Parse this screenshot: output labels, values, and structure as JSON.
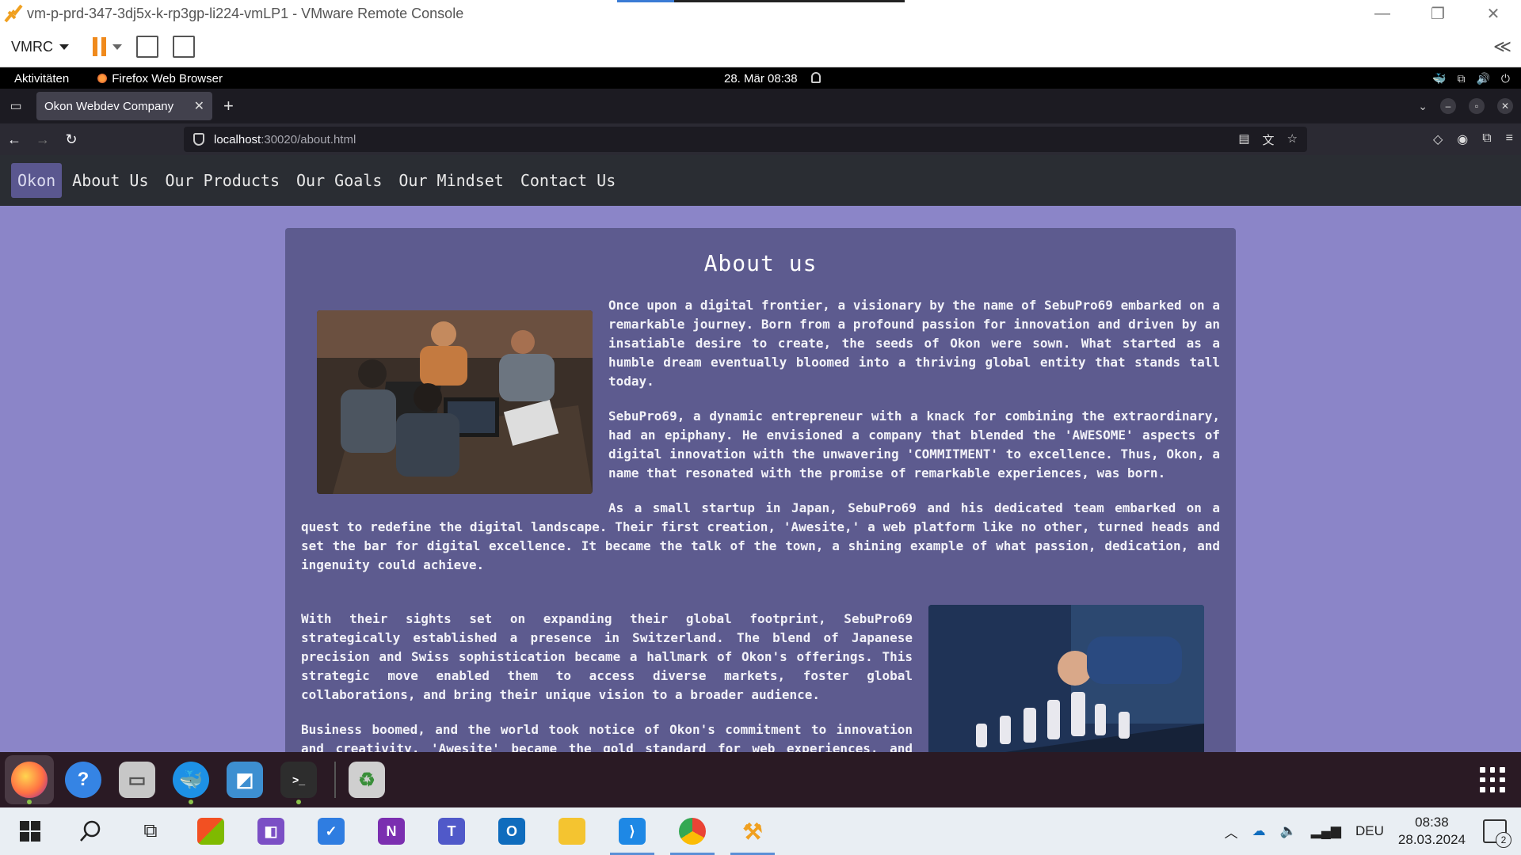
{
  "vmware": {
    "title": "vm-p-prd-347-3dj5x-k-rp3gp-li224-vmLP1 - VMware Remote Console",
    "menu_label": "VMRC",
    "controls": {
      "minimize": "—",
      "restore": "❐",
      "close": "✕"
    },
    "collapse_label": "≪"
  },
  "gnome": {
    "activities": "Aktivitäten",
    "app_name": "Firefox Web Browser",
    "clock": "28. Mär  08:38"
  },
  "firefox": {
    "tab_title": "Okon Webdev Company",
    "url_host": "localhost",
    "url_rest": ":30020/about.html"
  },
  "site": {
    "nav": [
      {
        "label": "Okon"
      },
      {
        "label": "About Us"
      },
      {
        "label": "Our Products"
      },
      {
        "label": "Our Goals"
      },
      {
        "label": "Our Mindset"
      },
      {
        "label": "Contact Us"
      }
    ],
    "heading": "About us",
    "paragraphs": [
      "Once upon a digital frontier, a visionary by the name of SebuPro69 embarked on a remarkable journey. Born from a profound passion for innovation and driven by an insatiable desire to create, the seeds of Okon were sown. What started as a humble dream eventually bloomed into a thriving global entity that stands tall today.",
      "SebuPro69, a dynamic entrepreneur with a knack for combining the extraordinary, had an epiphany. He envisioned a company that blended the 'AWESOME' aspects of digital innovation with the unwavering 'COMMITMENT' to excellence. Thus, Okon, a name that resonated with the promise of remarkable experiences, was born.",
      "As a small startup in Japan, SebuPro69 and his dedicated team embarked on a quest to redefine the digital landscape. Their first creation, 'Awesite,' a web platform like no other, turned heads and set the bar for digital excellence. It became the talk of the town, a shining example of what passion, dedication, and ingenuity could achieve.",
      "With their sights set on expanding their global footprint, SebuPro69 strategically established a presence in Switzerland. The blend of Japanese precision and Swiss sophistication became a hallmark of Okon's offerings. This strategic move enabled them to access diverse markets, foster global collaborations, and bring their unique vision to a broader audience.",
      "Business boomed, and the world took notice of Okon's commitment to innovation and creativity. 'Awesite' became the gold standard for web experiences, and 'Worldaround,' their Minecraft server, grew into a thriving virtual community."
    ]
  },
  "taskbar": {
    "language": "DEU",
    "time": "08:38",
    "date": "28.03.2024",
    "notification_count": "2"
  }
}
